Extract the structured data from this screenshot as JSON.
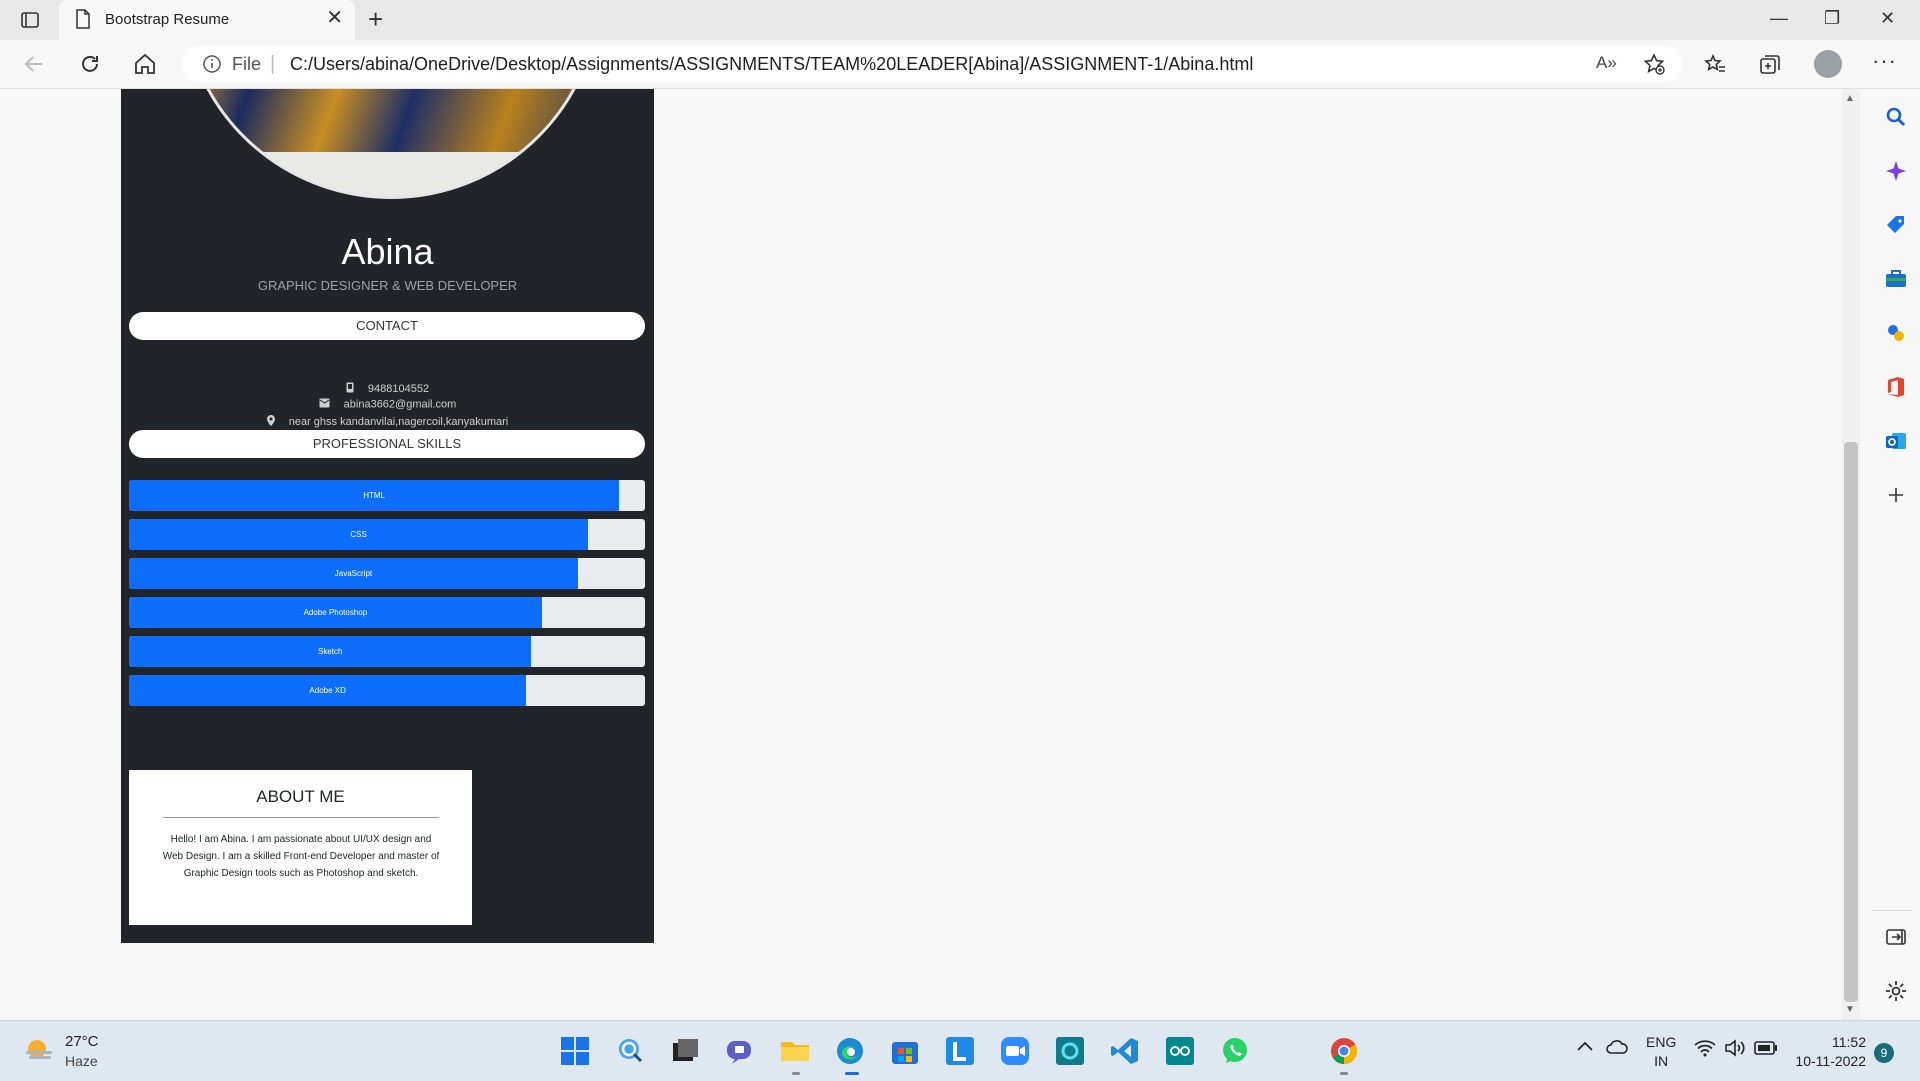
{
  "browser": {
    "tab_title": "Bootstrap Resume",
    "tab_close": "✕",
    "new_tab": "+",
    "address_label": "File",
    "url": "C:/Users/abina/OneDrive/Desktop/Assignments/ASSIGNMENTS/TEAM%20LEADER[Abina]/ASSIGNMENT-1/Abina.html",
    "read_aloud": "A»",
    "more": "···"
  },
  "window_controls": {
    "minimize": "—",
    "maximize": "❐",
    "close": "✕"
  },
  "resume": {
    "name": "Abina",
    "subtitle": "GRAPHIC DESIGNER & WEB DEVELOPER",
    "contact_heading": "CONTACT",
    "phone": "9488104552",
    "email": "abina3662@gmail.com",
    "address": "near ghss kandanvilai,nagercoil,kanyakumari",
    "skills_heading": "PROFESSIONAL SKILLS",
    "skills": [
      {
        "label": "HTML",
        "level": 0.95
      },
      {
        "label": "CSS",
        "level": 0.89
      },
      {
        "label": "JavaScript",
        "level": 0.87
      },
      {
        "label": "Adobe Photoshop",
        "level": 0.8
      },
      {
        "label": "Sketch",
        "level": 0.78
      },
      {
        "label": "Adobe XD",
        "level": 0.77
      }
    ],
    "about_title": "ABOUT ME",
    "about_text": "Hello! I am Abina. I am passionate about UI/UX design and Web Design. I am a skilled Front-end Developer and master of Graphic Design tools such as Photoshop and sketch."
  },
  "taskbar": {
    "temperature": "27°C",
    "weather": "Haze",
    "lang_top": "ENG",
    "lang_bottom": "IN",
    "time": "11:52",
    "date": "10-11-2022",
    "notifications": "9"
  },
  "colors": {
    "progress": "#0d6efd",
    "resume_bg": "#212529",
    "page_bg": "#f7f7f7"
  }
}
